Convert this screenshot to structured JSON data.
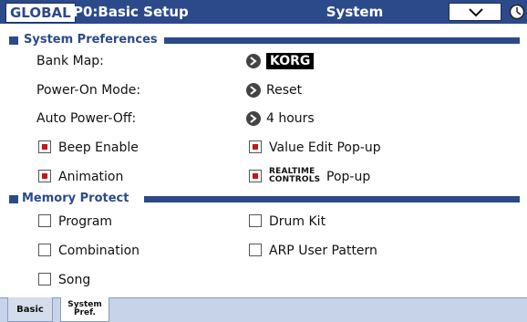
{
  "header": {
    "mode": "GLOBAL",
    "page": "P0:Basic Setup",
    "tab_title": "System Preferences"
  },
  "system_preferences": {
    "section_label": "System Preferences",
    "bank_map_label": "Bank Map:",
    "bank_map_value": "KORG",
    "power_on_mode_label": "Power-On Mode:",
    "power_on_mode_value": "Reset",
    "auto_power_off_label": "Auto Power-Off:",
    "auto_power_off_value": "4 hours",
    "beep_enable_label": "Beep Enable",
    "beep_enable_checked": true,
    "value_edit_popup_label": "Value Edit Pop-up",
    "value_edit_popup_checked": true,
    "animation_label": "Animation",
    "animation_checked": true,
    "realtime_line1": "REALTIME",
    "realtime_line2": "CONTROLS",
    "realtime_popup_suffix": "Pop-up",
    "realtime_popup_checked": true
  },
  "memory_protect": {
    "section_label": "Memory Protect",
    "program_label": "Program",
    "drum_kit_label": "Drum Kit",
    "combination_label": "Combination",
    "arp_user_pattern_label": "ARP User Pattern",
    "song_label": "Song"
  },
  "tabs": {
    "basic": "Basic",
    "system_line1": "System",
    "system_line2": "Pref."
  },
  "colors": {
    "accent": "#2c4a8a",
    "checkbox_on": "#c21717"
  }
}
